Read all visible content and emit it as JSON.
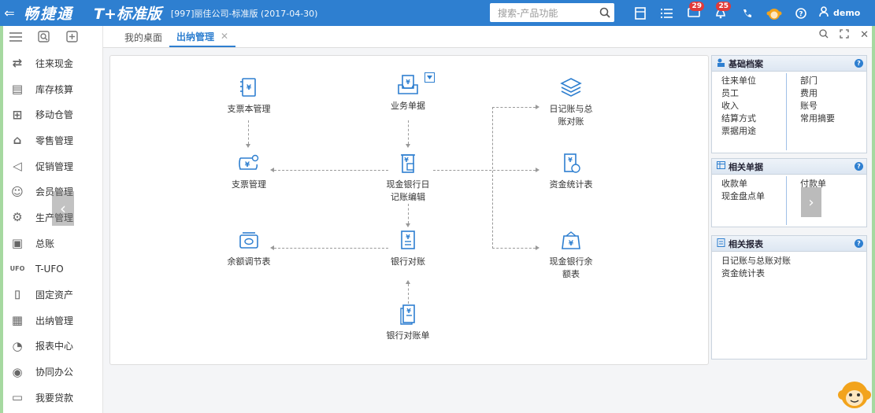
{
  "topbar": {
    "back_icon": "back-arrow-icon",
    "brand": "畅捷通",
    "product": "T+标准版",
    "company": "[997]丽佳公司-标准版  (2017-04-30)",
    "search_placeholder": "搜索-产品功能",
    "notifications_count": "29",
    "alerts_count": "25",
    "user": "demo"
  },
  "sidebar": {
    "items": [
      {
        "label": "往来现金",
        "icon": "transfer-icon"
      },
      {
        "label": "库存核算",
        "icon": "inventory-icon"
      },
      {
        "label": "移动仓管",
        "icon": "mobile-warehouse-icon"
      },
      {
        "label": "零售管理",
        "icon": "retail-icon"
      },
      {
        "label": "促销管理",
        "icon": "promotion-icon"
      },
      {
        "label": "会员管理",
        "icon": "member-icon"
      },
      {
        "label": "生产管理",
        "icon": "production-icon"
      },
      {
        "label": "总账",
        "icon": "ledger-icon"
      },
      {
        "label": "T-UFO",
        "icon": "ufo-icon"
      },
      {
        "label": "固定资产",
        "icon": "fixed-asset-icon"
      },
      {
        "label": "出纳管理",
        "icon": "cashier-icon"
      },
      {
        "label": "报表中心",
        "icon": "report-icon"
      },
      {
        "label": "协同办公",
        "icon": "collaboration-icon"
      },
      {
        "label": "我要贷款",
        "icon": "loan-icon"
      }
    ]
  },
  "tabs": [
    {
      "label": "我的桌面"
    },
    {
      "label": "出纳管理"
    }
  ],
  "flow": {
    "cheque_book": "支票本管理",
    "business_doc": "业务单据",
    "journal_recon": "日记账与总账对账",
    "cheque_mgmt": "支票管理",
    "cash_bank_journal": "现金银行日记账编辑",
    "fund_stats": "资金统计表",
    "balance_adjust": "余额调节表",
    "bank_recon": "银行对账",
    "cash_bank_balance": "现金银行余额表",
    "bank_statement": "银行对账单"
  },
  "panels": {
    "basic": {
      "title": "基础档案",
      "left": [
        "往来单位",
        "员工",
        "收入",
        "结算方式",
        "票据用途"
      ],
      "right": [
        "部门",
        "费用",
        "账号",
        "常用摘要"
      ]
    },
    "docs": {
      "title": "相关单据",
      "left": [
        "收款单",
        "现金盘点单"
      ],
      "right": [
        "付款单"
      ]
    },
    "reports": {
      "title": "相关报表",
      "items": [
        "日记账与总账对账",
        "资金统计表"
      ]
    }
  },
  "colors": {
    "accent": "#2e7fd0",
    "bg_frame": "#a6d9a0"
  }
}
